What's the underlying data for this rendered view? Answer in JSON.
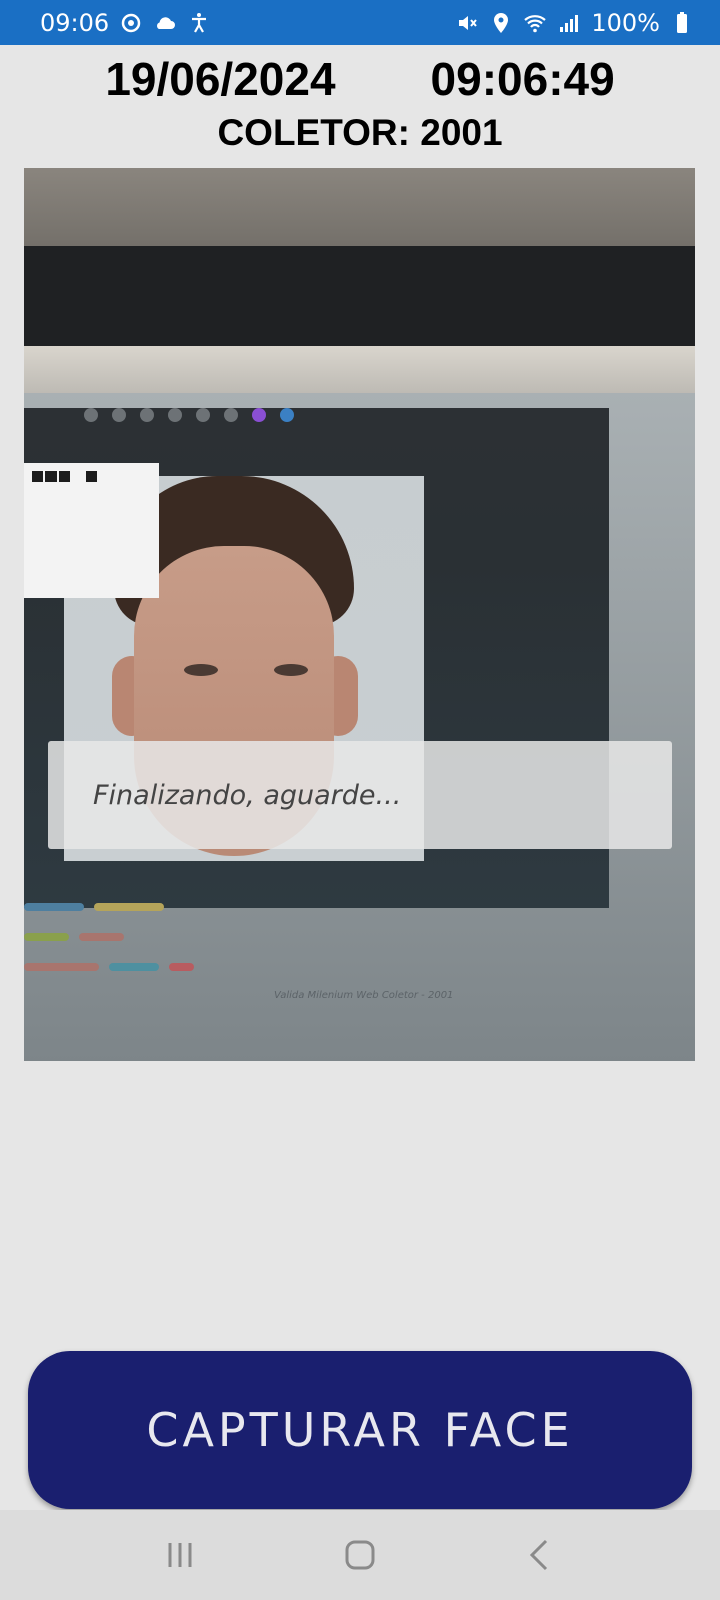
{
  "status_bar": {
    "time": "09:06",
    "battery": "100%",
    "left_icons": [
      "sync-icon",
      "cloud-icon",
      "accessibility-icon"
    ],
    "right_icons": [
      "mute-icon",
      "location-icon",
      "wifi-icon",
      "signal-icon",
      "battery-icon"
    ]
  },
  "header": {
    "date": "19/06/2024",
    "clock": "09:06:49",
    "collector": "COLETOR: 2001"
  },
  "camera": {
    "overlay_message": "Finalizando, aguarde...",
    "footer_text": "Valida Milenium Web Coletor - 2001"
  },
  "actions": {
    "capture_label": "CAPTURAR FACE"
  },
  "colors": {
    "status_bar": "#1a6fc4",
    "button": "#1a1f6f",
    "background": "#e6e6e6"
  }
}
